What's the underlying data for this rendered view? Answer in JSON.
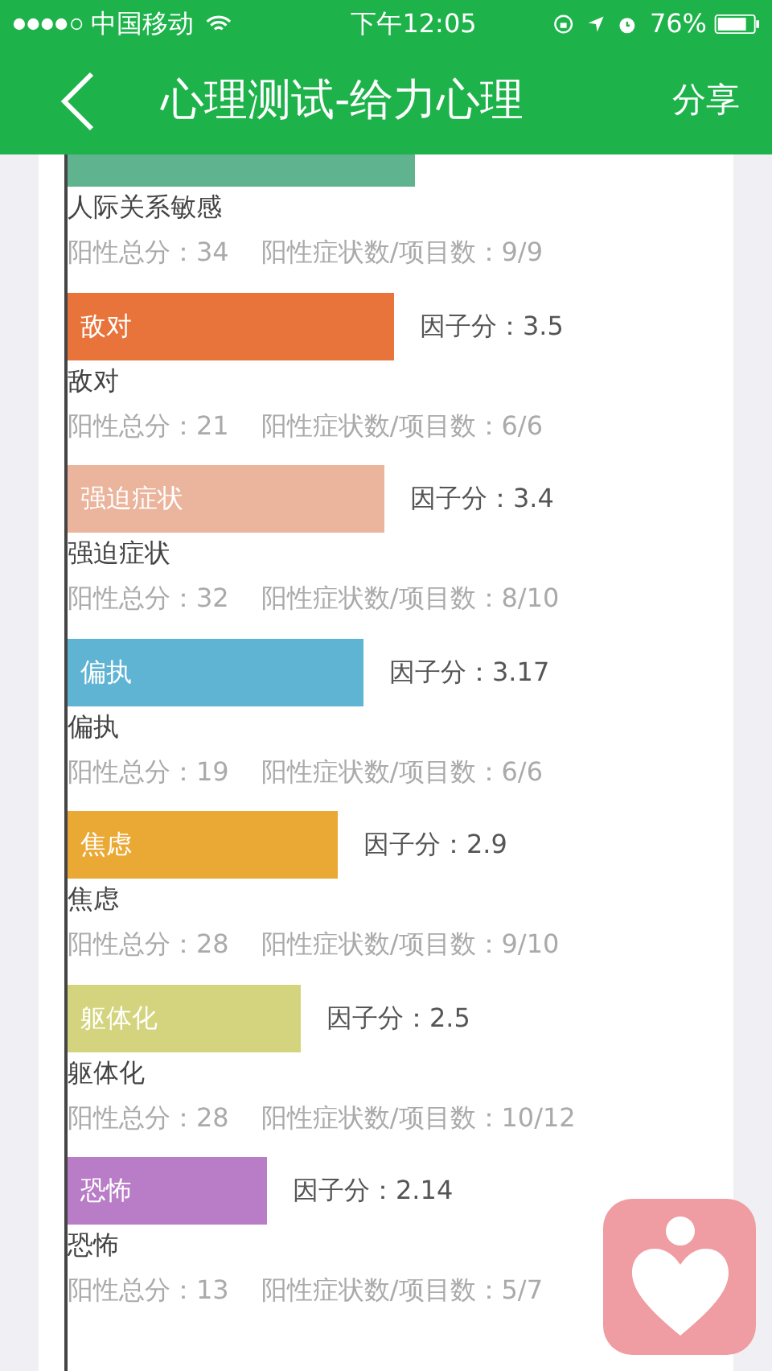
{
  "status_bar": {
    "carrier": "中国移动",
    "time": "下午12:05",
    "battery": "76%"
  },
  "nav": {
    "title": "心理测试-给力心理",
    "action": "分享"
  },
  "factors": [
    {
      "name": "人际关系敏感",
      "color": "#5fb38f",
      "total": "阳性总分：34",
      "ratio": "阳性症状数/项目数：9/9"
    },
    {
      "bar_label": "敌对",
      "score": "因子分：3.5",
      "name": "敌对",
      "color": "#e8743b",
      "total": "阳性总分：21",
      "ratio": "阳性症状数/项目数：6/6"
    },
    {
      "bar_label": "强迫症状",
      "score": "因子分：3.4",
      "name": "强迫症状",
      "color": "#ebb49c",
      "total": "阳性总分：32",
      "ratio": "阳性症状数/项目数：8/10"
    },
    {
      "bar_label": "偏执",
      "score": "因子分：3.17",
      "name": "偏执",
      "color": "#5fb3d3",
      "total": "阳性总分：19",
      "ratio": "阳性症状数/项目数：6/6"
    },
    {
      "bar_label": "焦虑",
      "score": "因子分：2.9",
      "name": "焦虑",
      "color": "#eaa934",
      "total": "阳性总分：28",
      "ratio": "阳性症状数/项目数：9/10"
    },
    {
      "bar_label": "躯体化",
      "score": "因子分：2.5",
      "name": "躯体化",
      "color": "#d4d47e",
      "total": "阳性总分：28",
      "ratio": "阳性症状数/项目数：10/12"
    },
    {
      "bar_label": "恐怖",
      "score": "因子分：2.14",
      "name": "恐怖",
      "color": "#b97dc7",
      "total": "阳性总分：13",
      "ratio": "阳性症状数/项目数：5/7"
    }
  ]
}
